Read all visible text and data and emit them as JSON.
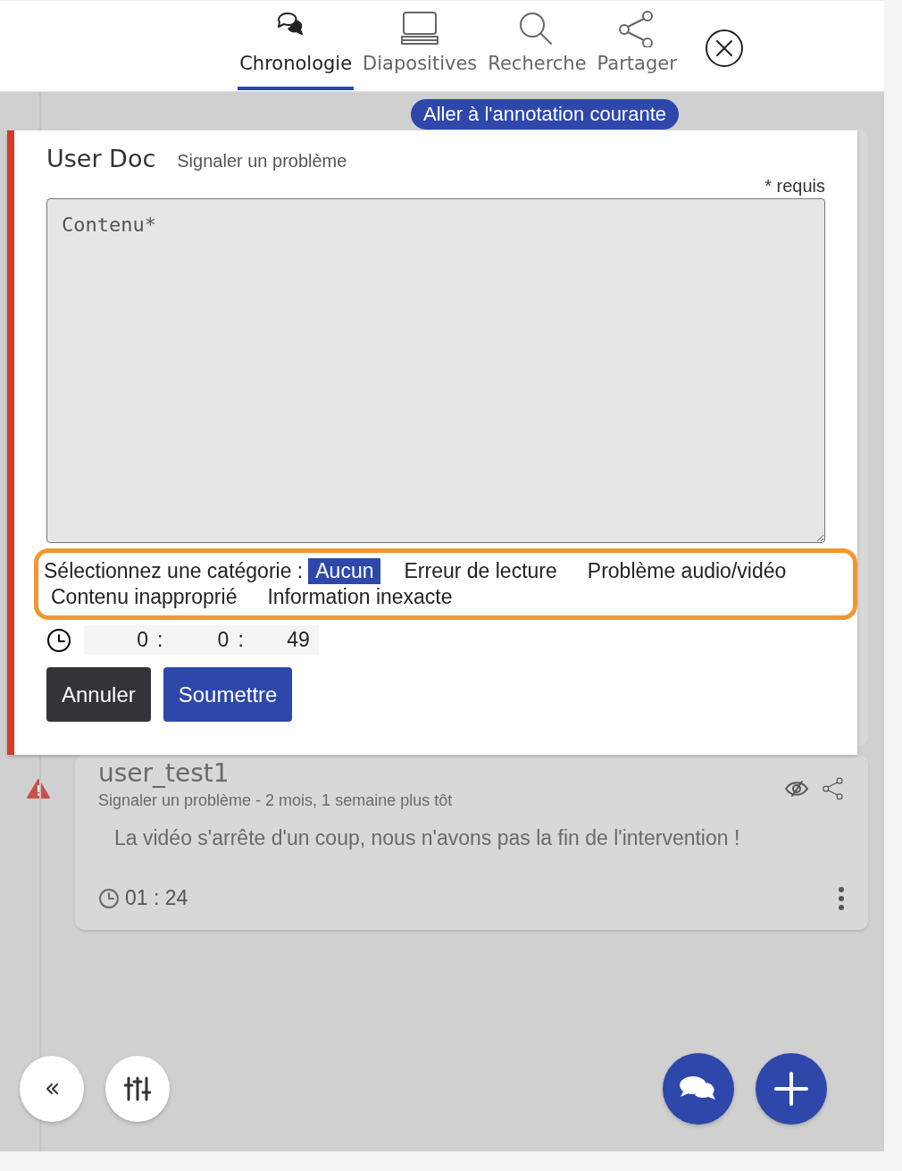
{
  "nav": {
    "tabs": [
      {
        "label": "Chronologie",
        "kind": "chat",
        "selected": true
      },
      {
        "label": "Diapositives",
        "kind": "slides",
        "selected": false
      },
      {
        "label": "Recherche",
        "kind": "search",
        "selected": false
      },
      {
        "label": "Partager",
        "kind": "share",
        "selected": false
      }
    ]
  },
  "jump_button": "Aller à l'annotation courante",
  "form": {
    "title": "User Doc",
    "subtitle": "Signaler un problème",
    "required_note": "* requis",
    "content": {
      "placeholder": "Contenu*"
    },
    "category_label": "Sélectionnez une catégorie :",
    "categories": [
      {
        "label": "Aucun",
        "selected": true
      },
      {
        "label": "Erreur de lecture",
        "selected": false
      },
      {
        "label": "Problème audio/vidéo",
        "selected": false
      },
      {
        "label": "Contenu inapproprié",
        "selected": false
      },
      {
        "label": "Information inexacte",
        "selected": false
      }
    ],
    "time": [
      {
        "value": "0",
        "separator": ":"
      },
      {
        "value": "0",
        "separator": ":"
      },
      {
        "value": "49"
      }
    ],
    "buttons": [
      {
        "label": "Annuler",
        "kind": "cancel"
      },
      {
        "label": "Soumettre",
        "kind": "submit"
      }
    ]
  },
  "annotation": {
    "kind": "warning",
    "author": "user_test1",
    "meta": "Signaler un problème - 2 mois, 1 semaine plus tôt",
    "text": "La vidéo s'arrête d'un coup, nous n'avons pas la fin de l'intervention !",
    "time": "01 : 24"
  }
}
